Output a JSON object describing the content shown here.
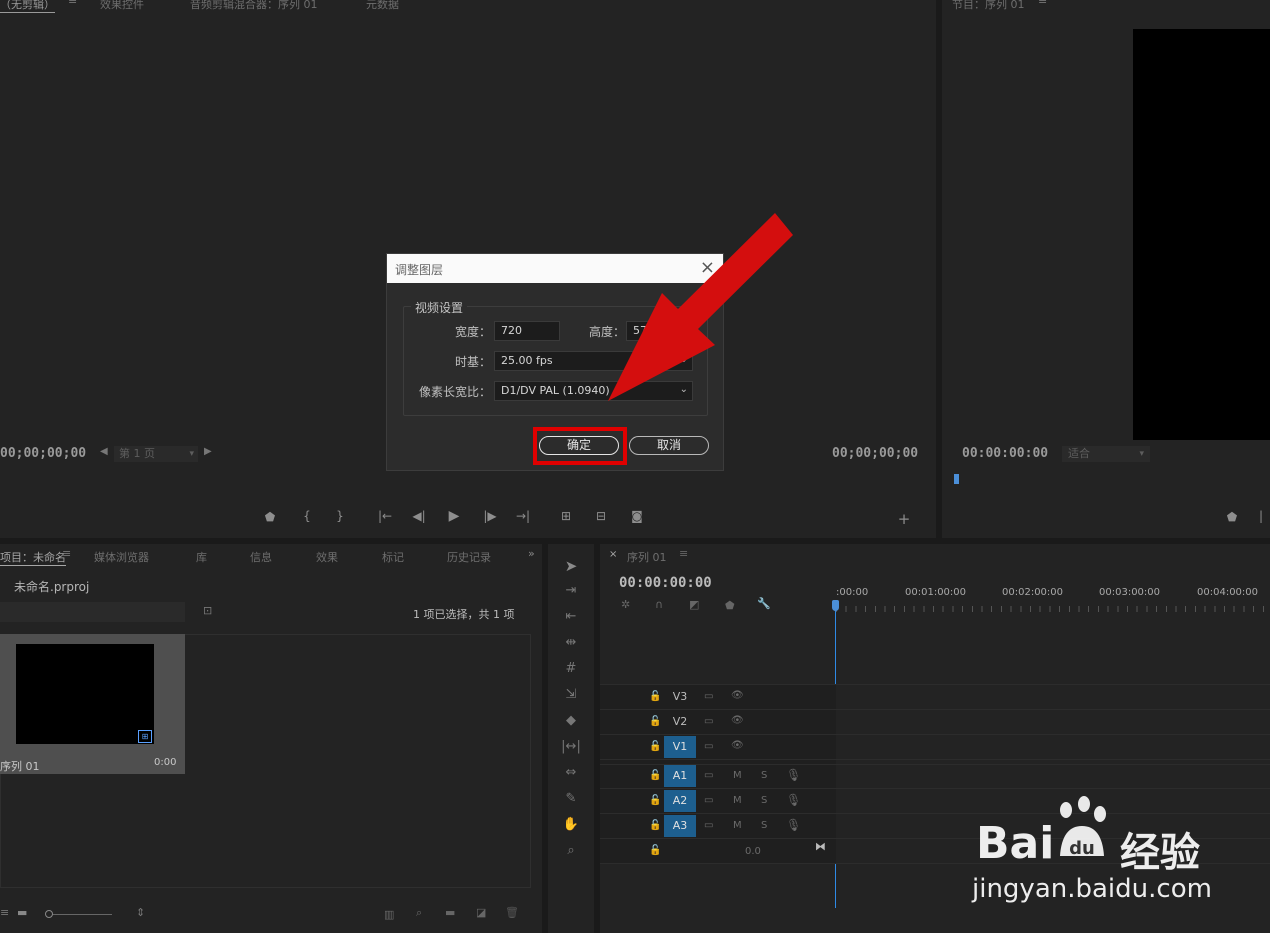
{
  "source_monitor": {
    "tabs": [
      "（无剪辑）",
      "效果控件",
      "音频剪辑混合器：序列 01",
      "元数据"
    ],
    "timecode_left": "00;00;00;00",
    "timecode_right": "00;00;00;00",
    "page_select": "第 1 页"
  },
  "program_monitor": {
    "tab": "节目：序列 01",
    "timecode": "00:00:00:00",
    "fit_select": "适合"
  },
  "project_panel": {
    "tabs": [
      "项目：未命名",
      "媒体浏览器",
      "库",
      "信息",
      "效果",
      "标记",
      "历史记录"
    ],
    "project_file": "未命名.prproj",
    "selection_status": "1 项已选择，共 1 项",
    "item_name": "序列 01",
    "item_duration": "0:00"
  },
  "timeline": {
    "tab": "序列 01",
    "timecode": "00:00:00:00",
    "ruler": [
      ":00:00",
      "00:01:00:00",
      "00:02:00:00",
      "00:03:00:00",
      "00:04:00:00"
    ],
    "video_tracks": [
      "V3",
      "V2",
      "V1"
    ],
    "audio_tracks": [
      "A1",
      "A2",
      "A3"
    ],
    "mute_label": "M",
    "solo_label": "S",
    "master_value": "0.0"
  },
  "dialog": {
    "title": "调整图层",
    "group_label": "视频设置",
    "width_label": "宽度：",
    "width_value": "720",
    "height_label": "高度：",
    "height_value": "576",
    "timebase_label": "时基：",
    "timebase_value": "25.00 fps",
    "par_label": "像素长宽比：",
    "par_value": "D1/DV PAL (1.0940)",
    "ok_label": "确定",
    "cancel_label": "取消"
  },
  "watermark": {
    "brand": "Bai",
    "brand_cn": "经验",
    "url": "jingyan.baidu.com"
  },
  "colors": {
    "accent_blue": "#2f8ae5",
    "track_on": "#1d5f8f",
    "highlight_red": "#e00000",
    "arrow_red": "#d40e0e"
  }
}
